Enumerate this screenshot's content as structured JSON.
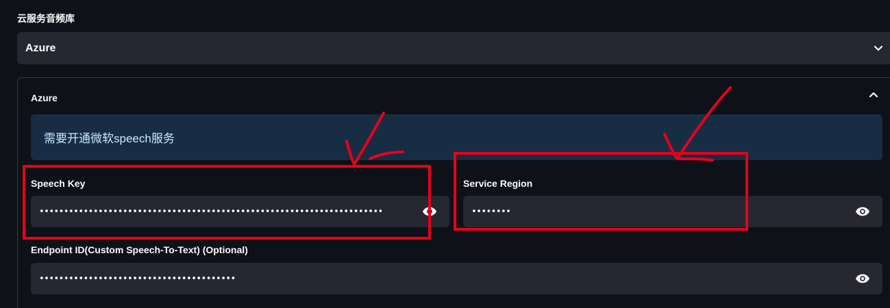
{
  "section": {
    "label": "云服务音频库"
  },
  "provider_select": {
    "value": "Azure"
  },
  "expander": {
    "title": "Azure"
  },
  "info": {
    "text": "需要开通微软speech服务"
  },
  "fields": {
    "speech_key": {
      "label": "Speech Key",
      "value": "••••••••••••••••••••••••••••••••••••••••••••••••••••••••••••••••••••••••••••••••••••••••"
    },
    "service_region": {
      "label": "Service Region",
      "value": "••••••••"
    },
    "endpoint_id": {
      "label": "Endpoint ID(Custom Speech-To-Text) (Optional)",
      "value": "••••••••••••••••••••••••••••••••••••••••"
    }
  },
  "colors": {
    "background": "#0e1117",
    "input_bg": "#262730",
    "info_bg": "#172d43",
    "info_text": "#c7ebff",
    "annotation": "#e8001c"
  },
  "icons": {
    "eye": "eye-icon",
    "select_chevron": "chevron-down-icon",
    "expander_chevron": "chevron-up-icon"
  }
}
